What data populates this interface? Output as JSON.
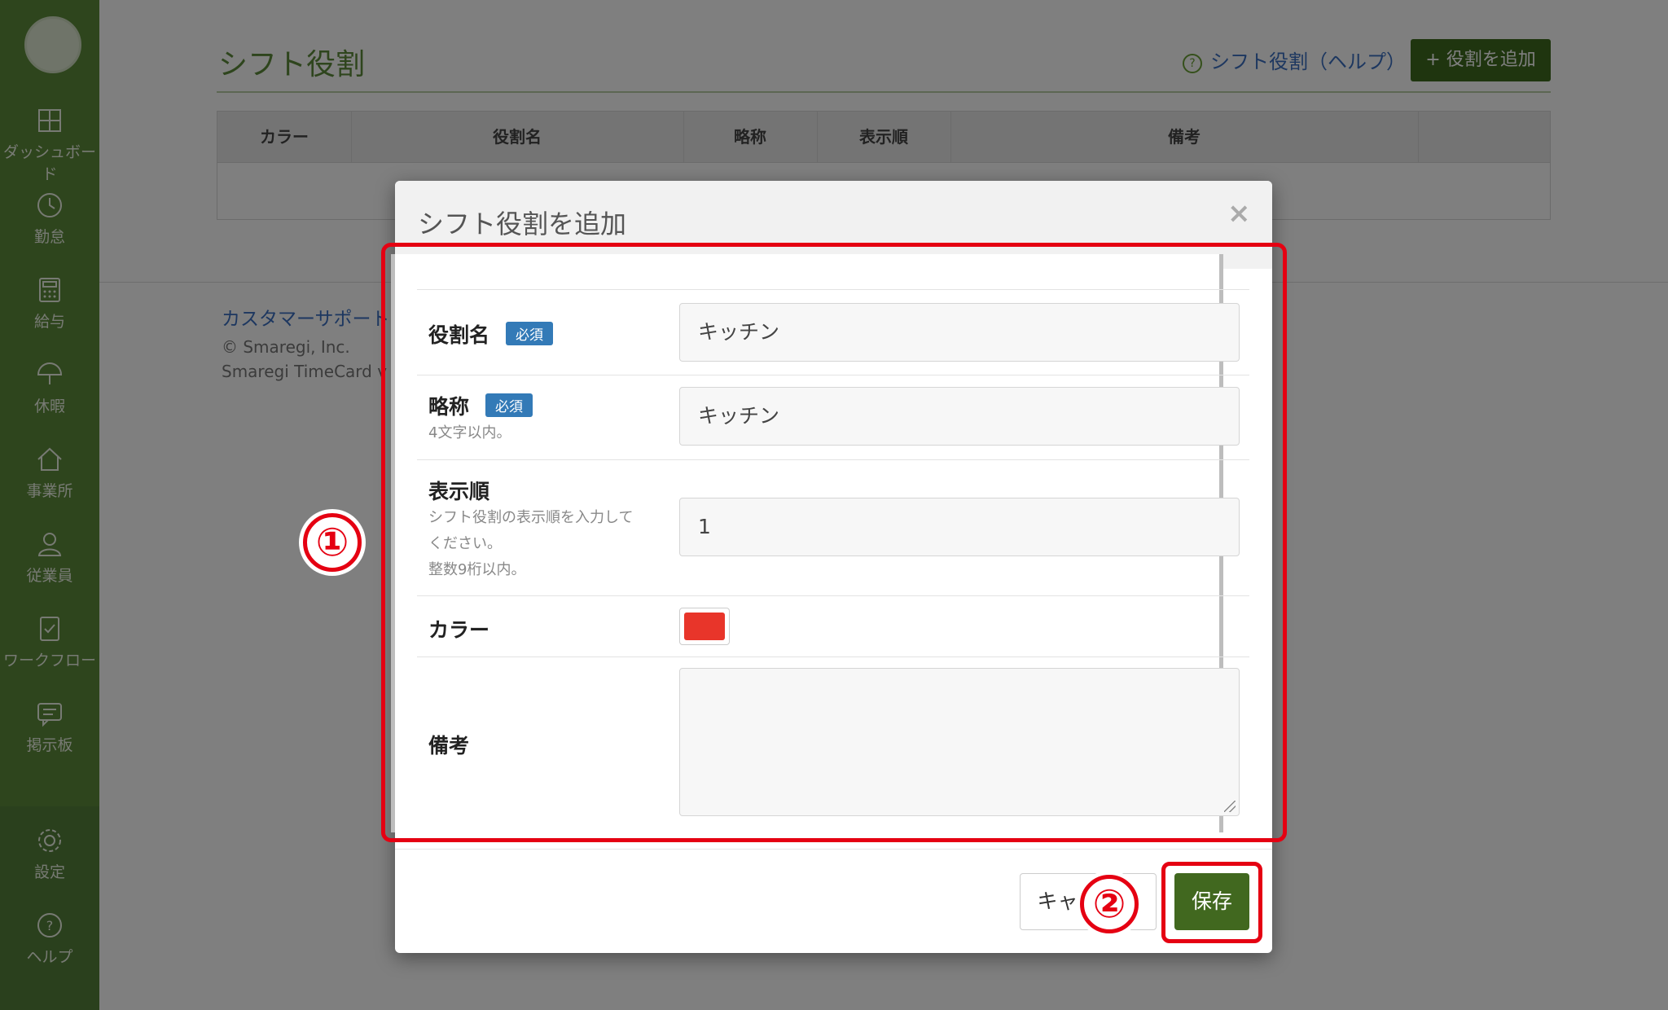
{
  "sidebar": {
    "items": [
      {
        "label": "ダッシュボード",
        "icon": "dashboard-icon"
      },
      {
        "label": "勤怠",
        "icon": "clock-icon"
      },
      {
        "label": "給与",
        "icon": "calculator-icon"
      },
      {
        "label": "休暇",
        "icon": "umbrella-icon"
      },
      {
        "label": "事業所",
        "icon": "home-icon"
      },
      {
        "label": "従業員",
        "icon": "person-icon"
      },
      {
        "label": "ワークフロー",
        "icon": "checklist-icon"
      },
      {
        "label": "掲示板",
        "icon": "message-icon"
      },
      {
        "label": "設定",
        "icon": "gear-icon"
      },
      {
        "label": "ヘルプ",
        "icon": "help-icon"
      }
    ]
  },
  "page": {
    "title": "シフト役割",
    "help_link": "シフト役割（ヘルプ）",
    "add_button": "+ 役割を追加",
    "table_headers": [
      "カラー",
      "役割名",
      "略称",
      "表示順",
      "備考",
      ""
    ]
  },
  "footer": {
    "support_link": "カスタマーサポート",
    "copyright": "© Smaregi, Inc.",
    "version": "Smaregi TimeCard v"
  },
  "modal": {
    "title": "シフト役割を追加",
    "close": "×",
    "required_badge": "必須",
    "fields": {
      "role_name": {
        "label": "役割名",
        "value": "キッチン"
      },
      "abbr": {
        "label": "略称",
        "help": "4文字以内。",
        "value": "キッチン"
      },
      "order": {
        "label": "表示順",
        "help1": "シフト役割の表示順を入力して",
        "help2": "ください。",
        "help3": "整数9桁以内。",
        "value": "1"
      },
      "color": {
        "label": "カラー",
        "value": "#e8352a"
      },
      "notes": {
        "label": "備考",
        "value": ""
      }
    },
    "cancel": "キャンセル",
    "save": "保存"
  },
  "annotations": {
    "marker1": "①",
    "marker2": "②"
  }
}
